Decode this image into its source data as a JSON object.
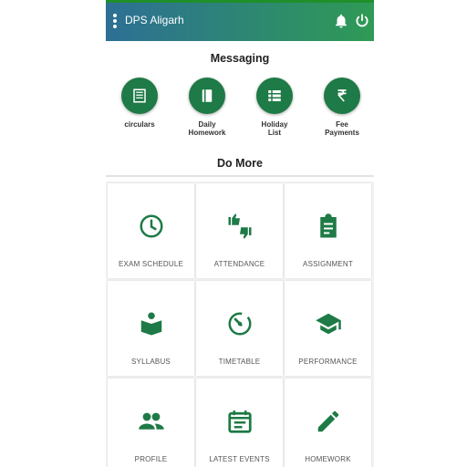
{
  "app": {
    "title": "DPS Aligarh"
  },
  "sections": {
    "messaging": "Messaging",
    "do_more": "Do More"
  },
  "messaging_items": [
    {
      "label": "circulars",
      "icon": "newspaper-icon"
    },
    {
      "label": "Daily\nHomework",
      "icon": "book-icon"
    },
    {
      "label": "Holiday\nList",
      "icon": "list-icon"
    },
    {
      "label": "Fee\nPayments",
      "icon": "rupee-icon"
    }
  ],
  "tiles": [
    {
      "label": "EXAM SCHEDULE",
      "icon": "clock-icon"
    },
    {
      "label": "ATTENDANCE",
      "icon": "thumbs-icon"
    },
    {
      "label": "ASSIGNMENT",
      "icon": "clipboard-icon"
    },
    {
      "label": "SYLLABUS",
      "icon": "reading-book-icon"
    },
    {
      "label": "TIMETABLE",
      "icon": "timer-icon"
    },
    {
      "label": "PERFORMANCE",
      "icon": "graduation-cap-icon"
    },
    {
      "label": "PROFILE",
      "icon": "people-icon"
    },
    {
      "label": "LATEST EVENTS",
      "icon": "calendar-icon"
    },
    {
      "label": "HOMEWORK",
      "icon": "pencil-icon"
    }
  ],
  "colors": {
    "accent": "#1e7a46",
    "appbar_start": "#2d6f95",
    "appbar_end": "#2f9a55"
  }
}
